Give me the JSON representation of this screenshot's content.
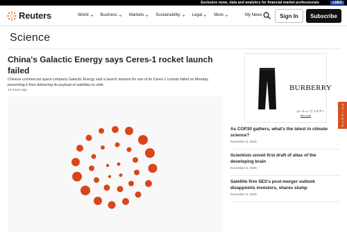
{
  "promo": {
    "text": "Exclusive news, data and analytics for financial market professionals",
    "badge": "LSEG"
  },
  "header": {
    "logo_text": "Reuters",
    "nav": [
      {
        "label": "World"
      },
      {
        "label": "Business"
      },
      {
        "label": "Markets"
      },
      {
        "label": "Sustainability"
      },
      {
        "label": "Legal"
      },
      {
        "label": "More"
      }
    ],
    "my_news": "My News",
    "sign_in": "Sign In",
    "subscribe": "Subscribe"
  },
  "section": {
    "title": "Science"
  },
  "main_article": {
    "headline": "China's Galactic Energy says Ceres-1 rocket launch failed",
    "summary": "Chinese commercial space company Galactic Energy said a launch mission for one of its Ceres-1 rockets failed on Monday, preventing it from delivering its payload of satellites to orbit.",
    "timestamp": "15 hours ago"
  },
  "ad": {
    "brand": "BURBERRY",
    "caption": "ユーチューブ テキサー",
    "url": "abc.com"
  },
  "feedback": {
    "label": "フィードバック"
  },
  "rail": [
    {
      "title": "As COP30 gathers, what's the latest in climate science?",
      "date": "November 9, 2025"
    },
    {
      "title": "Scientists unveil first draft of atlas of the developing brain",
      "date": "November 6, 2025"
    },
    {
      "title": "Satellite firm SES's post-merger outlook disappoints investors, shares slump",
      "date": "November 6, 2025"
    }
  ],
  "colors": {
    "accent": "#d5511e",
    "dark": "#111111",
    "lseg": "#1e50c8"
  }
}
